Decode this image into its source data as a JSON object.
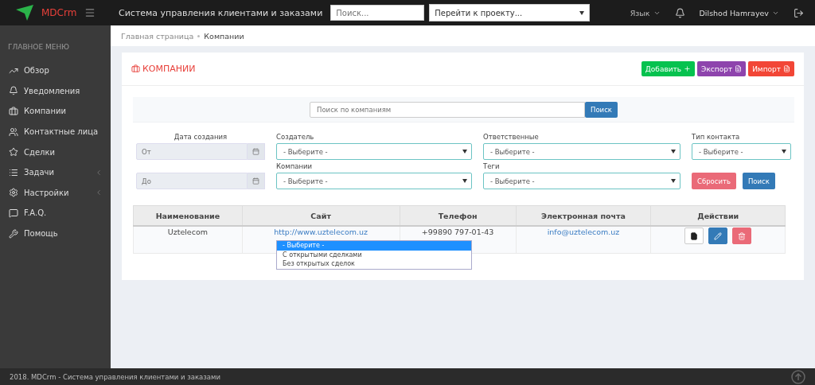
{
  "topbar": {
    "brand": "MDCrm",
    "title": "Система управления клиентами и заказами",
    "search": {
      "placeholder": "Поиск..."
    },
    "project_select": {
      "placeholder": "Перейти к проекту..."
    },
    "language": "Язык",
    "user": "Dilshod Hamrayev"
  },
  "sidebar": {
    "heading": "ГЛАВНОЕ МЕНЮ",
    "items": [
      {
        "label": "Обзор",
        "has_submenu": false
      },
      {
        "label": "Уведомления",
        "has_submenu": false
      },
      {
        "label": "Компании",
        "has_submenu": false
      },
      {
        "label": "Контактные лица",
        "has_submenu": false
      },
      {
        "label": "Сделки",
        "has_submenu": false
      },
      {
        "label": "Задачи",
        "has_submenu": true
      },
      {
        "label": "Настройки",
        "has_submenu": true
      },
      {
        "label": "F.A.Q.",
        "has_submenu": false
      },
      {
        "label": "Помощь",
        "has_submenu": false
      }
    ]
  },
  "breadcrumb": [
    "Главная страница",
    "Компании"
  ],
  "page_title": "КОМПАНИИ",
  "header_buttons": [
    {
      "label": "Добавить",
      "kind": "add"
    },
    {
      "label": "Экспорт",
      "kind": "export"
    },
    {
      "label": "Импорт",
      "kind": "import"
    }
  ],
  "company_search": {
    "placeholder": "Поиск по компаниям",
    "button": "Поиск"
  },
  "filters": {
    "date_label": "Дата создания",
    "date_from": {
      "placeholder": "От"
    },
    "date_to": {
      "placeholder": "До"
    },
    "creator": {
      "label": "Создатель",
      "value": "- Выберите -"
    },
    "responsible": {
      "label": "Ответственные",
      "value": "- Выберите -"
    },
    "contact_type": {
      "label": "Тип контакта",
      "value": "- Выберите -"
    },
    "companies": {
      "label": "Компании",
      "value": "- Выберите -",
      "options": [
        {
          "label": "- Выберите -",
          "selected": true
        },
        {
          "label": "С открытыми сделками",
          "selected": false
        },
        {
          "label": "Без открытых сделок",
          "selected": false
        }
      ]
    },
    "tags": {
      "label": "Теги",
      "value": "- Выберите -"
    },
    "reset": "Сбросить",
    "search": "Поиск"
  },
  "table": {
    "columns": [
      "Наименование",
      "Сайт",
      "Телефон",
      "Электронная почта",
      "Действии"
    ],
    "rows": [
      {
        "name": "Uztelecom",
        "site": "http://www.uztelecom.uz",
        "phone": "+99890 797-01-43",
        "email": "info@uztelecom.uz"
      }
    ]
  },
  "footer": "2018. MDCrm - Система управления клиентами и заказами"
}
